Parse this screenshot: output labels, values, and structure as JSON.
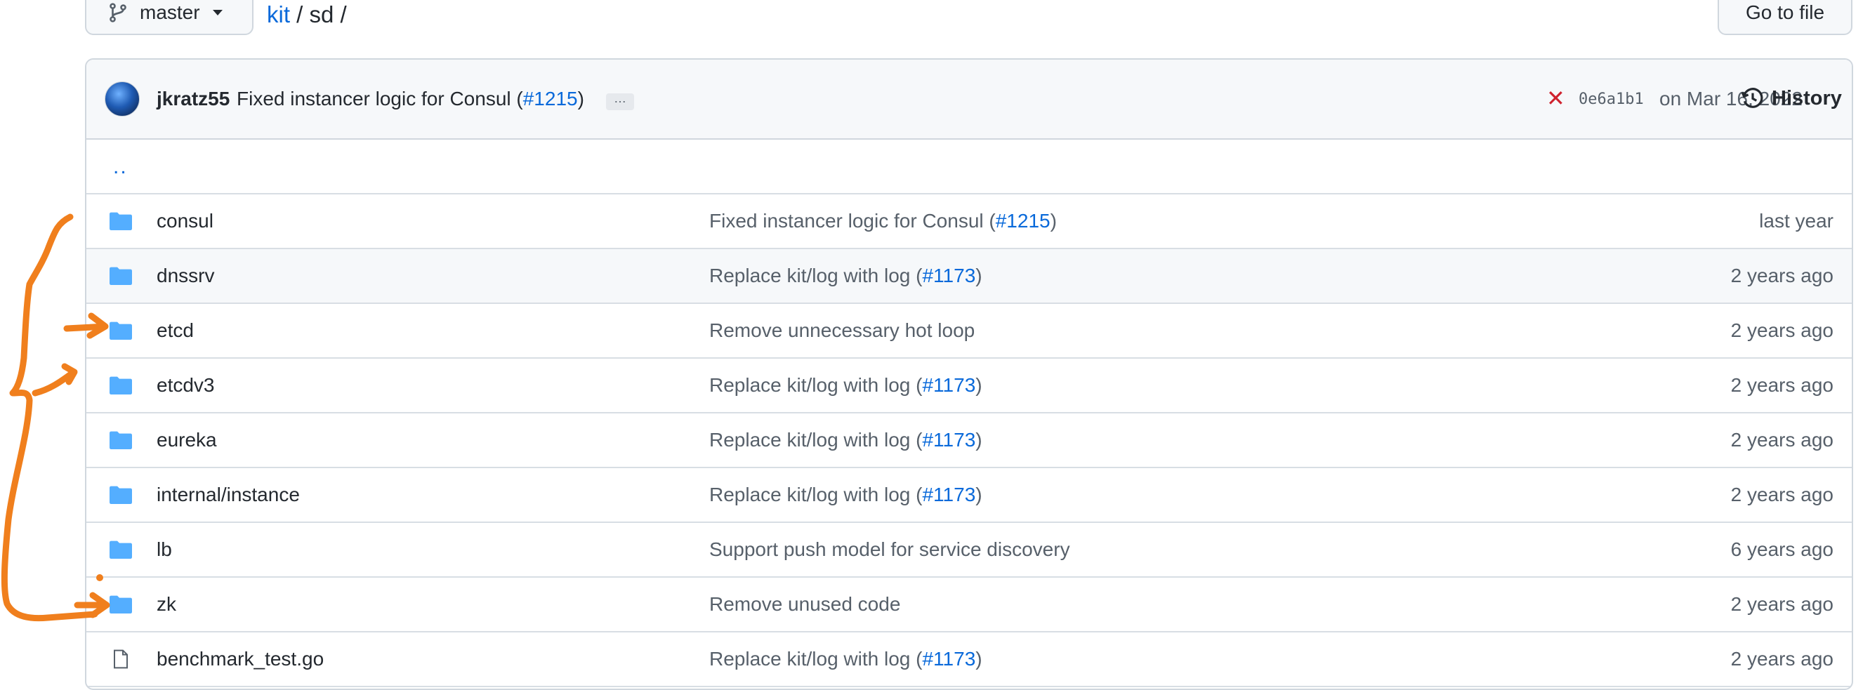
{
  "branch": {
    "name": "master"
  },
  "breadcrumb": {
    "repo": "kit",
    "sep1": "/",
    "folder": "sd",
    "sep2": "/"
  },
  "goto_file": {
    "label": "Go to file"
  },
  "latest_commit": {
    "author": "jkratz55",
    "message": "Fixed instancer logic for Consul (",
    "pr": "#1215",
    "message_end": ")",
    "expand": "…",
    "status": "✕",
    "sha": "0e6a1b1",
    "date": "on Mar 16, 2022",
    "history_label": "History"
  },
  "parent_dir": "..",
  "files": [
    {
      "type": "folder",
      "name": "consul",
      "message": "Fixed instancer logic for Consul (",
      "pr": "#1215",
      "message_end": ")",
      "age": "last year"
    },
    {
      "type": "folder",
      "name": "dnssrv",
      "message": "Replace kit/log with log (",
      "pr": "#1173",
      "message_end": ")",
      "age": "2 years ago"
    },
    {
      "type": "folder",
      "name": "etcd",
      "message": "Remove unnecessary hot loop",
      "pr": "",
      "message_end": "",
      "age": "2 years ago"
    },
    {
      "type": "folder",
      "name": "etcdv3",
      "message": "Replace kit/log with log (",
      "pr": "#1173",
      "message_end": ")",
      "age": "2 years ago"
    },
    {
      "type": "folder",
      "name": "eureka",
      "message": "Replace kit/log with log (",
      "pr": "#1173",
      "message_end": ")",
      "age": "2 years ago"
    },
    {
      "type": "folder",
      "name": "internal/instance",
      "message": "Replace kit/log with log (",
      "pr": "#1173",
      "message_end": ")",
      "age": "2 years ago"
    },
    {
      "type": "folder",
      "name": "lb",
      "message": "Support push model for service discovery",
      "pr": "",
      "message_end": "",
      "age": "6 years ago"
    },
    {
      "type": "folder",
      "name": "zk",
      "message": "Remove unused code",
      "pr": "",
      "message_end": "",
      "age": "2 years ago"
    },
    {
      "type": "file",
      "name": "benchmark_test.go",
      "message": "Replace kit/log with log (",
      "pr": "#1173",
      "message_end": ")",
      "age": "2 years ago"
    }
  ],
  "colors": {
    "accent": "#0969da",
    "folder": "#54aeff",
    "annotation": "#f07f1d",
    "fail": "#cf222e"
  },
  "icons": {
    "branch": "git-branch-icon",
    "folder": "folder-icon",
    "file": "file-icon",
    "history": "history-clock-icon",
    "status": "x-icon"
  }
}
